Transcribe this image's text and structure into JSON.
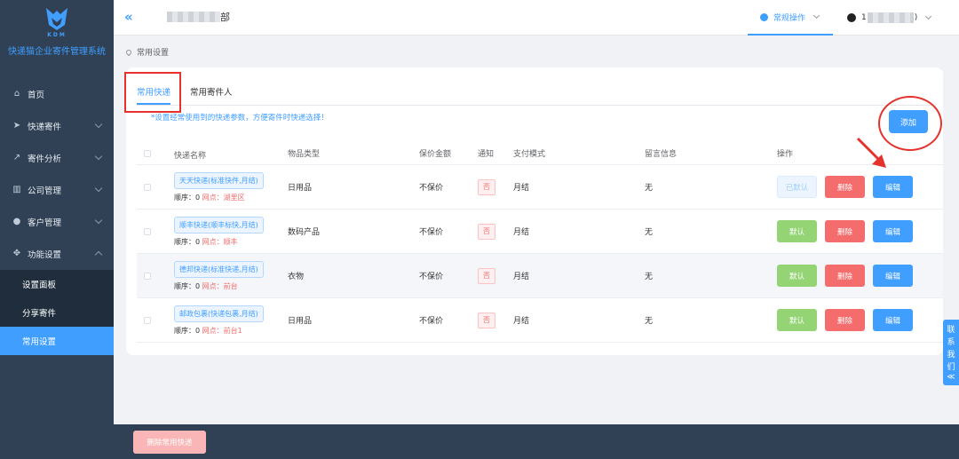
{
  "app": {
    "logo_letters": "KDM",
    "title": "快递猫企业寄件管理系统"
  },
  "sidebar": {
    "items": [
      {
        "label": "首页",
        "icon": "home-icon"
      },
      {
        "label": "快递寄件",
        "icon": "send-icon"
      },
      {
        "label": "寄件分析",
        "icon": "chart-icon"
      },
      {
        "label": "公司管理",
        "icon": "building-icon"
      },
      {
        "label": "客户管理",
        "icon": "user-icon"
      },
      {
        "label": "功能设置",
        "icon": "settings-icon"
      }
    ],
    "sub_items": [
      {
        "label": "设置面板"
      },
      {
        "label": "分享寄件"
      },
      {
        "label": "常用设置"
      }
    ]
  },
  "header": {
    "org_suffix": "部",
    "ops_label": "常规操作",
    "user_prefix": "1",
    "user_suffix": ")"
  },
  "breadcrumb": {
    "current": "常用设置"
  },
  "tabs": [
    {
      "label": "常用快递"
    },
    {
      "label": "常用寄件人"
    }
  ],
  "hint": "*设置经常使用到的快递参数，方便寄件时快递选择！",
  "add_label": "添加",
  "table": {
    "headers": {
      "name": "快递名称",
      "type": "物品类型",
      "insured": "保价金额",
      "notify": "通知",
      "pay": "支付模式",
      "message": "留言信息",
      "ops": "操作"
    },
    "rows": [
      {
        "name": "天天快递(标准快件,月结)",
        "order": "顺序：0",
        "net_label": "网点：",
        "net_value": "湖里区",
        "type": "日用品",
        "insured": "不保价",
        "notify": "否",
        "pay": "月结",
        "message": "无",
        "default_label": "已默认"
      },
      {
        "name": "顺丰快递(顺丰标快,月结)",
        "order": "顺序：0",
        "net_label": "网点：",
        "net_value": "顺丰",
        "type": "数码产品",
        "insured": "不保价",
        "notify": "否",
        "pay": "月结",
        "message": "无",
        "default_label": "默认"
      },
      {
        "name": "德邦快递(标准快递,月结)",
        "order": "顺序：0",
        "net_label": "网点：",
        "net_value": "前台",
        "type": "衣物",
        "insured": "不保价",
        "notify": "否",
        "pay": "月结",
        "message": "无",
        "default_label": "默认"
      },
      {
        "name": "邮政包裹(快递包裹,月结)",
        "order": "顺序：0",
        "net_label": "网点：",
        "net_value": "前台1",
        "type": "日用品",
        "insured": "不保价",
        "notify": "否",
        "pay": "月结",
        "message": "无",
        "default_label": "默认"
      }
    ],
    "delete_label": "删除",
    "edit_label": "编辑"
  },
  "bulk_delete_label": "删除常用快递",
  "contact": [
    "联",
    "系",
    "我",
    "们",
    "≪"
  ],
  "colors": {
    "sidebar": "#304156",
    "accent": "#409eff",
    "danger": "#f56c6c",
    "success": "#95d475",
    "annotation": "#e5322d"
  }
}
